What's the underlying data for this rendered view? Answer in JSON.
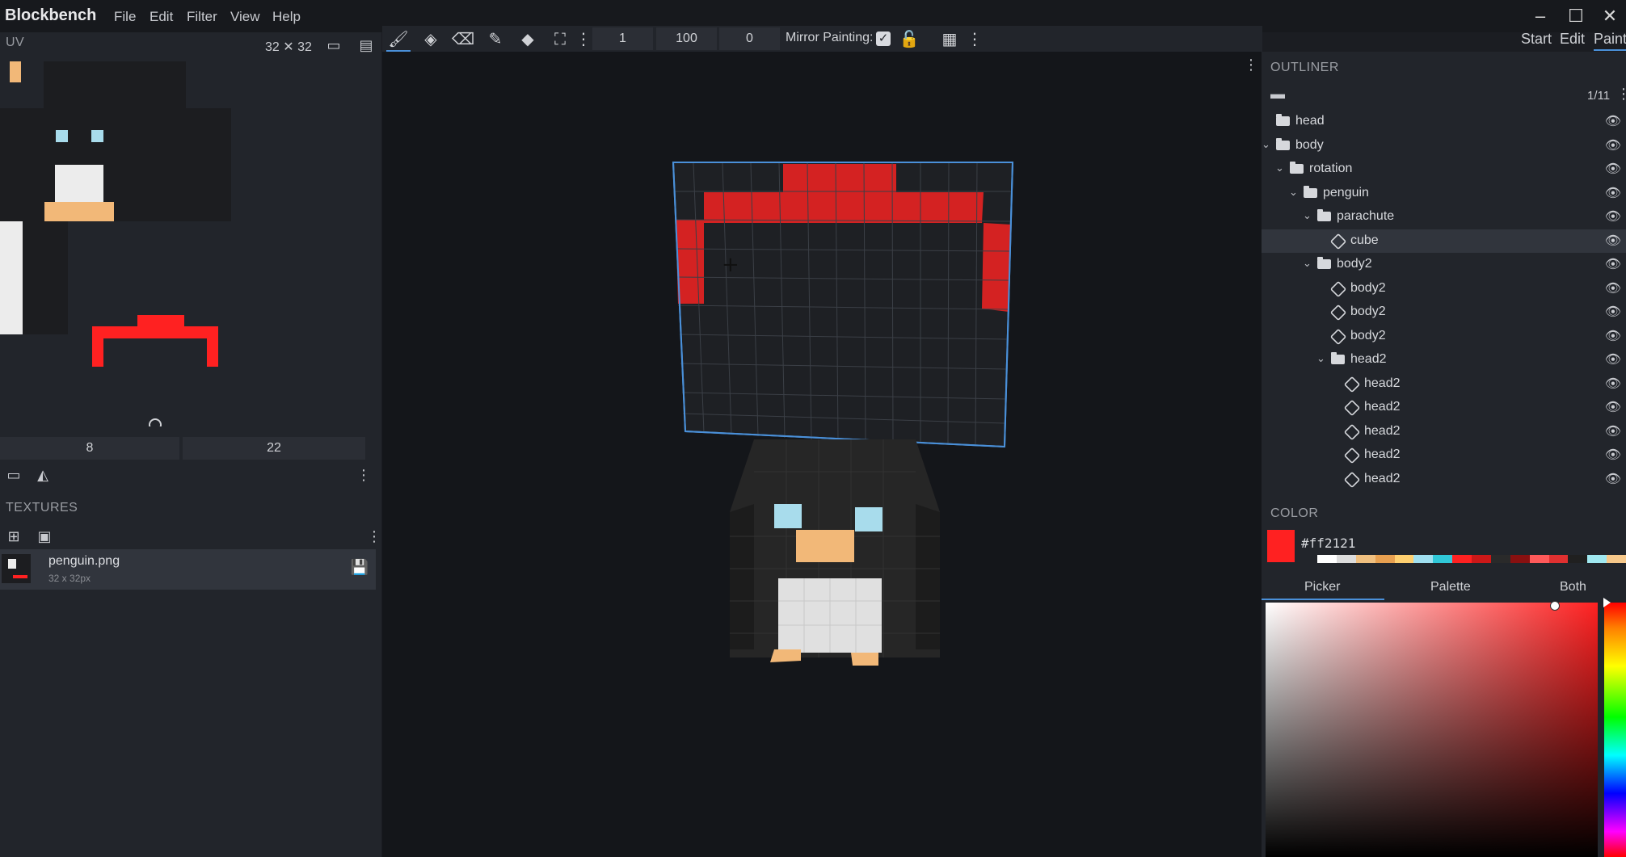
{
  "app": {
    "title": "Blockbench"
  },
  "menu": [
    "File",
    "Edit",
    "Filter",
    "View",
    "Help"
  ],
  "window_controls": {
    "minimize": "–",
    "maximize": "☐",
    "close": "✕"
  },
  "toolbar": {
    "brush_size": "1",
    "opacity": "100",
    "softness": "0",
    "mirror_label": "Mirror Painting:",
    "modes": [
      "Start",
      "Edit",
      "Paint"
    ]
  },
  "uv": {
    "title": "UV",
    "size": "32 ✕ 32",
    "pos_x": "8",
    "pos_y": "22"
  },
  "textures": {
    "title": "TEXTURES",
    "items": [
      {
        "name": "penguin.png",
        "size": "32 x 32px"
      }
    ]
  },
  "outliner": {
    "title": "OUTLINER",
    "count": "1/11",
    "items": [
      {
        "label": "head",
        "type": "group",
        "depth": 0,
        "expanded": false
      },
      {
        "label": "body",
        "type": "group",
        "depth": 0,
        "expanded": true
      },
      {
        "label": "rotation",
        "type": "group",
        "depth": 1,
        "expanded": true
      },
      {
        "label": "penguin",
        "type": "group",
        "depth": 2,
        "expanded": true
      },
      {
        "label": "parachute",
        "type": "group",
        "depth": 3,
        "expanded": true
      },
      {
        "label": "cube",
        "type": "cube",
        "depth": 4,
        "selected": true
      },
      {
        "label": "body2",
        "type": "group",
        "depth": 3,
        "expanded": true
      },
      {
        "label": "body2",
        "type": "cube",
        "depth": 4
      },
      {
        "label": "body2",
        "type": "cube",
        "depth": 4
      },
      {
        "label": "body2",
        "type": "cube",
        "depth": 4
      },
      {
        "label": "head2",
        "type": "group",
        "depth": 4,
        "expanded": true
      },
      {
        "label": "head2",
        "type": "cube",
        "depth": 5
      },
      {
        "label": "head2",
        "type": "cube",
        "depth": 5
      },
      {
        "label": "head2",
        "type": "cube",
        "depth": 5
      },
      {
        "label": "head2",
        "type": "cube",
        "depth": 5
      },
      {
        "label": "head2",
        "type": "cube",
        "depth": 5
      }
    ]
  },
  "color": {
    "title": "COLOR",
    "hex": "#ff2121",
    "swatch": "#ff2121",
    "tabs": [
      "Picker",
      "Palette",
      "Both"
    ],
    "active_tab": "Picker",
    "palette": [
      "#ffffff",
      "#dcdcdc",
      "#f0c080",
      "#e8a050",
      "#ffd070",
      "#a0e0f0",
      "#30c8d8",
      "#ff2121",
      "#cc1818",
      "#2a2a2a",
      "#881010",
      "#ff5a5a",
      "#e03030",
      "#202020",
      "#a0e8f0",
      "#f6c88a"
    ]
  },
  "colors": {
    "accent": "#4a90d9",
    "red": "#ff2121",
    "penguin_dark": "#262626",
    "penguin_eye": "#a8dcec",
    "penguin_beak": "#f2b878",
    "penguin_belly": "#e6e6e6"
  }
}
